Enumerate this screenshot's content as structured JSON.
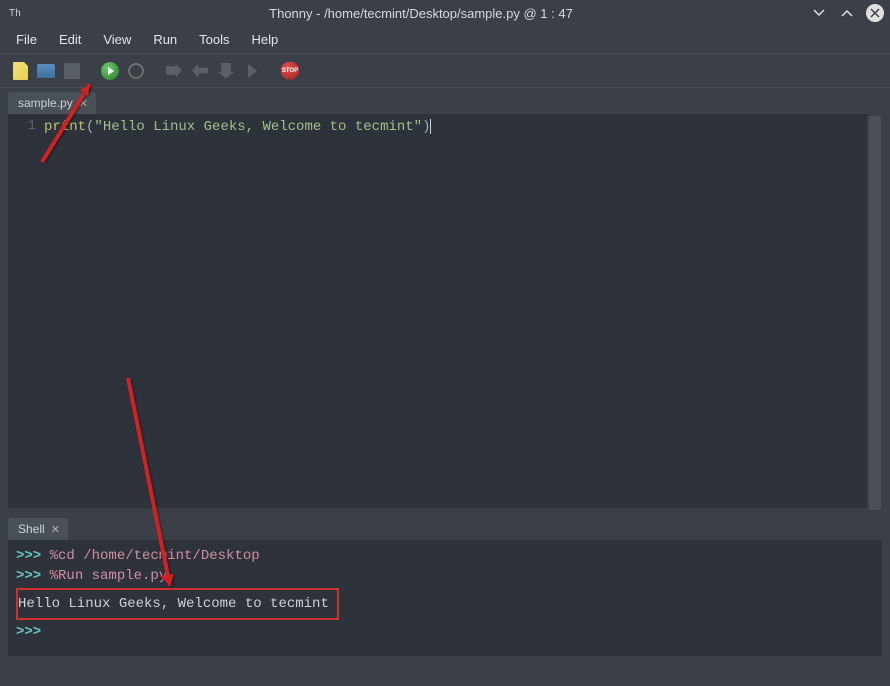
{
  "window": {
    "app_icon_text": "Th",
    "title": "Thonny  -  /home/tecmint/Desktop/sample.py  @  1 : 47"
  },
  "menu": {
    "items": [
      "File",
      "Edit",
      "View",
      "Run",
      "Tools",
      "Help"
    ]
  },
  "toolbar": {
    "stop_label": "STOP"
  },
  "editor": {
    "tab_label": "sample.py",
    "line_number": "1",
    "code": {
      "func": "print",
      "open_paren": "(",
      "string": "\"Hello Linux Geeks, Welcome to tecmint\"",
      "close_paren": ")"
    }
  },
  "shell": {
    "tab_label": "Shell",
    "lines": [
      {
        "prompt": ">>> ",
        "magic": "%cd /home/tecmint/Desktop"
      },
      {
        "prompt": ">>> ",
        "magic": "%Run sample.py"
      }
    ],
    "output": "Hello Linux Geeks, Welcome to tecmint",
    "final_prompt": ">>> "
  }
}
